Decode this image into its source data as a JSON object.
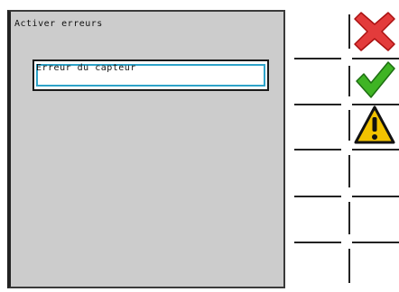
{
  "dialog": {
    "title": "Activer erreurs",
    "sensor_item": "Erreur du capteur"
  },
  "softkeys": [
    {
      "icon": "close-icon",
      "color": "#e33b3b"
    },
    {
      "icon": "check-icon",
      "color": "#3fb424"
    },
    {
      "icon": "warning-icon",
      "color": "#f2c200"
    },
    {
      "icon": ""
    },
    {
      "icon": ""
    },
    {
      "icon": ""
    }
  ]
}
